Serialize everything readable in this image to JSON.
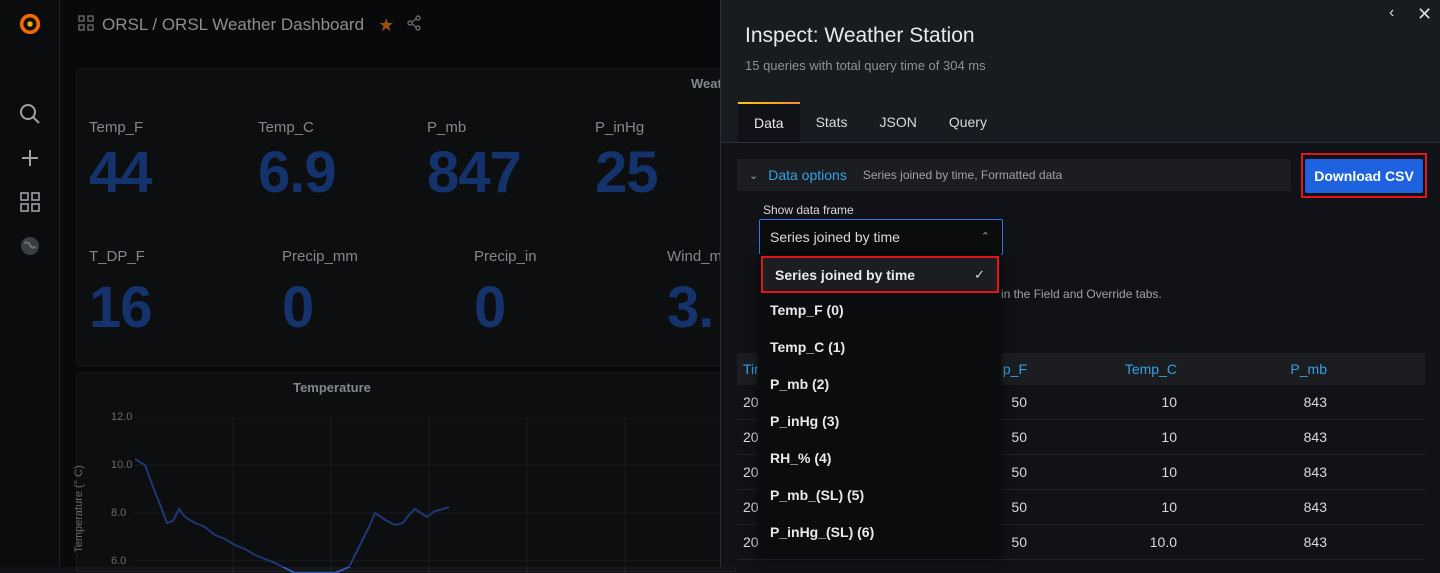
{
  "breadcrumb": {
    "text": "ORSL / ORSL Weather Dashboard"
  },
  "stats_row1": [
    {
      "label": "Temp_F",
      "value": "44"
    },
    {
      "label": "Temp_C",
      "value": "6.9"
    },
    {
      "label": "P_mb",
      "value": "847"
    },
    {
      "label": "P_inHg",
      "value": "25"
    }
  ],
  "stats_row2": [
    {
      "label": "T_DP_F",
      "value": "16"
    },
    {
      "label": "Precip_mm",
      "value": "0"
    },
    {
      "label": "Precip_in",
      "value": "0"
    },
    {
      "label": "Wind_m",
      "value": "3."
    }
  ],
  "weather_panel_title_fragment": "Weat",
  "temperature_panel": {
    "title": "Temperature",
    "ylabel": "Temperature (° C)",
    "yticks": [
      "12.0",
      "10.0",
      "8.0",
      "6.0"
    ]
  },
  "inspect": {
    "title": "Inspect: Weather Station",
    "subtitle": "15 queries with total query time of 304 ms",
    "tabs": [
      "Data",
      "Stats",
      "JSON",
      "Query"
    ],
    "data_options_title": "Data options",
    "data_options_desc": "Series joined by time, Formatted data",
    "download_label": "Download CSV",
    "show_frame_label": "Show data frame",
    "selected_frame": "Series joined by time",
    "hint_fragment": "in the Field and Override tabs."
  },
  "dropdown_options": [
    "Series joined by time",
    "Temp_F (0)",
    "Temp_C (1)",
    "P_mb (2)",
    "P_inHg (3)",
    "RH_% (4)",
    "P_mb_(SL) (5)",
    "P_inHg_(SL) (6)"
  ],
  "table": {
    "headers": [
      "Tin",
      "p_F",
      "Temp_C",
      "P_mb"
    ],
    "rows": [
      [
        "20",
        "50",
        "10",
        "843"
      ],
      [
        "20",
        "50",
        "10",
        "843"
      ],
      [
        "20",
        "50",
        "10",
        "843"
      ],
      [
        "20",
        "50",
        "10",
        "843"
      ],
      [
        "20",
        "50",
        "10.0",
        "843"
      ]
    ]
  }
}
